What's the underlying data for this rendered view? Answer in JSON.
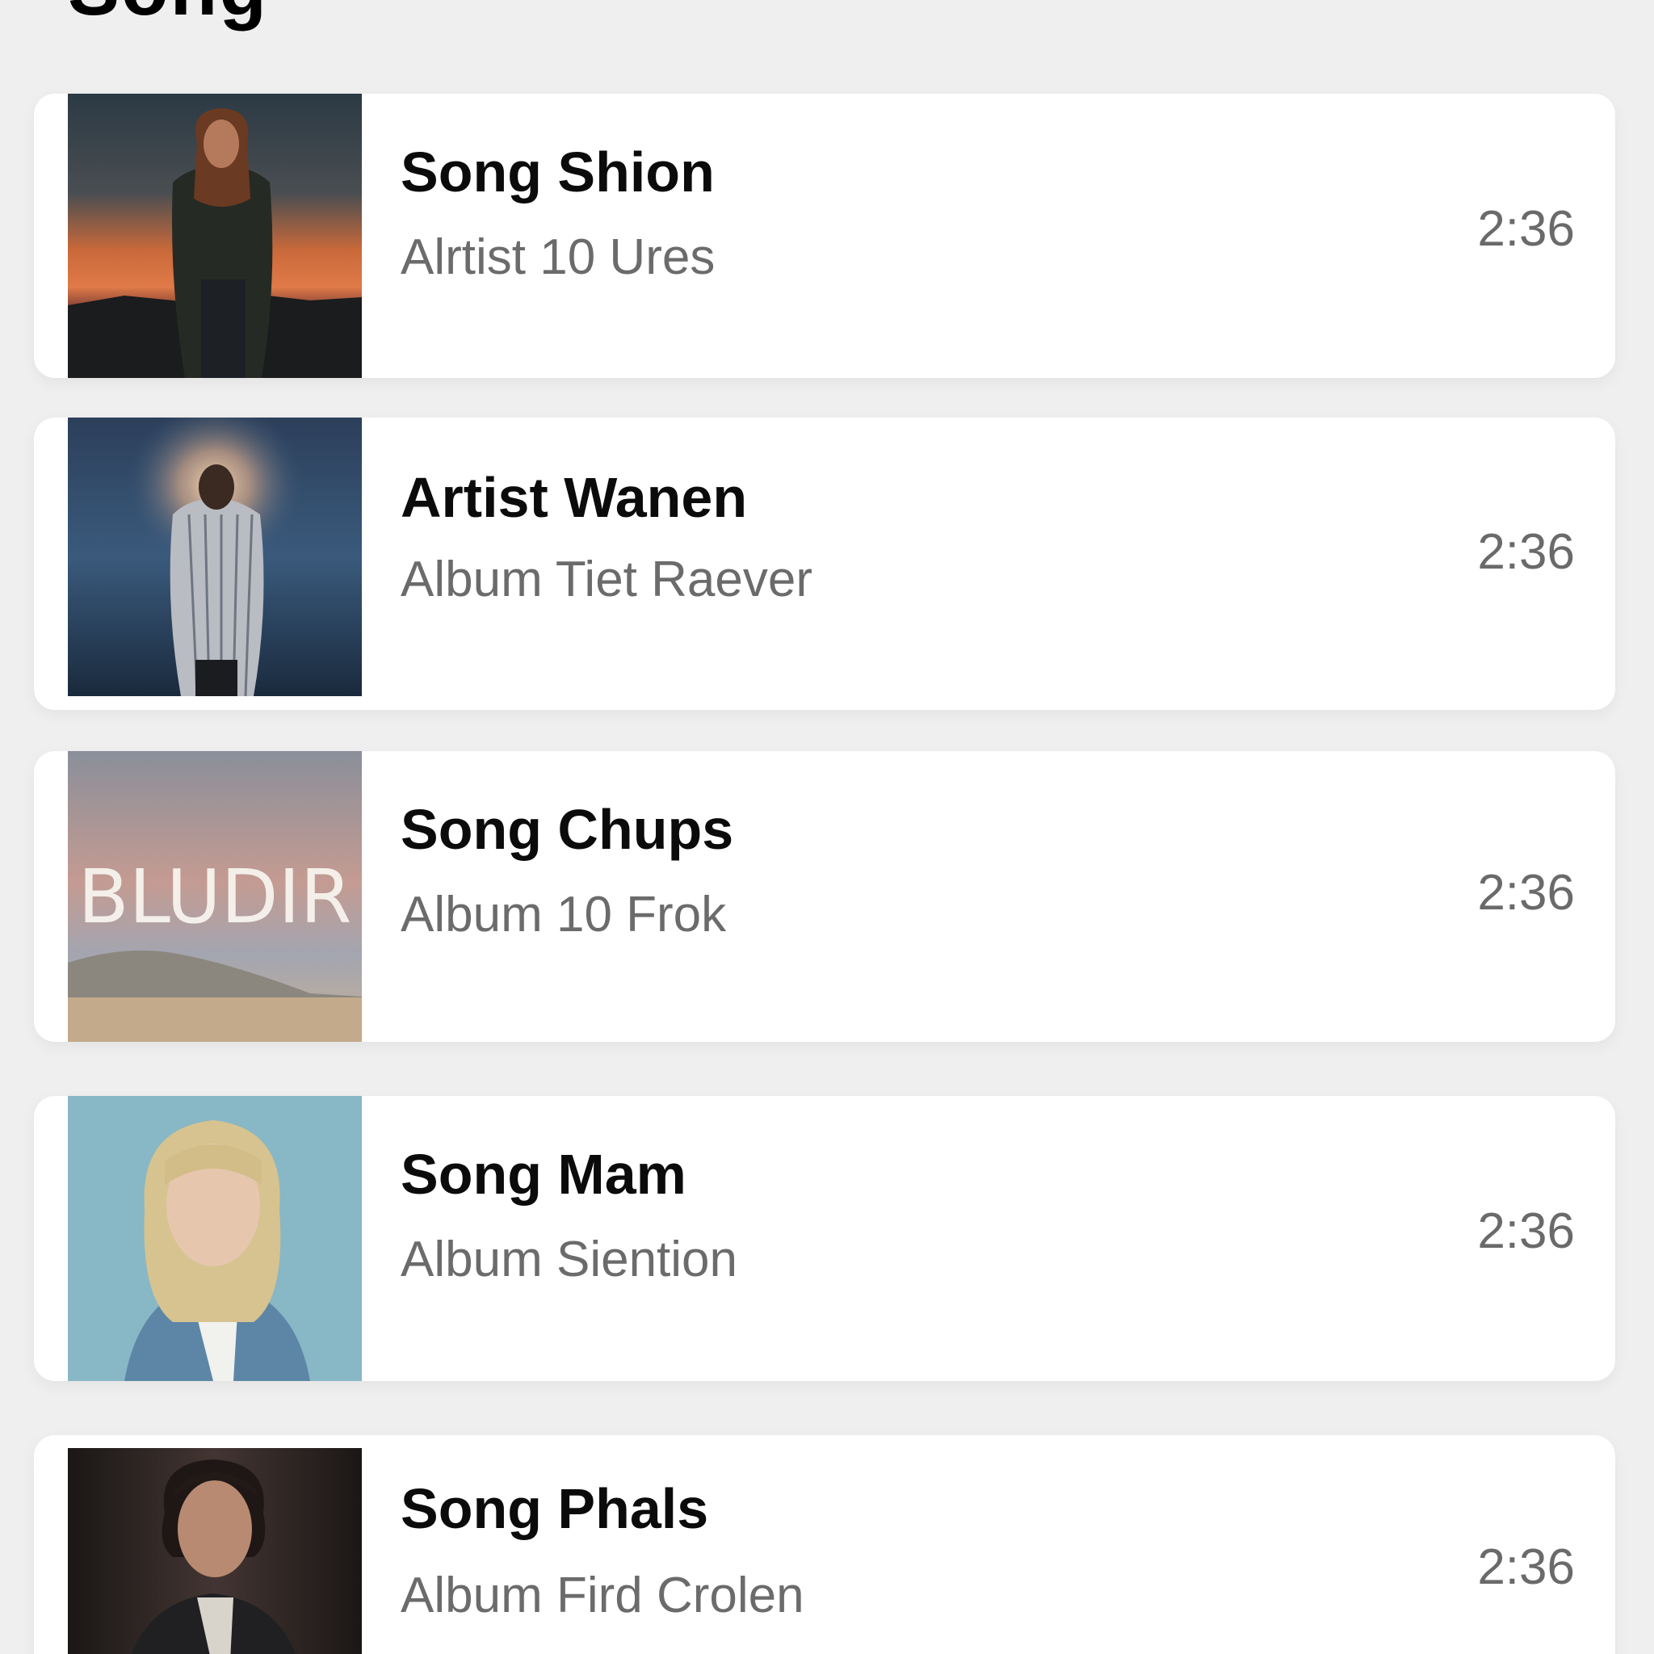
{
  "header": {
    "title": "Song"
  },
  "songs": [
    {
      "title": "Song Shion",
      "subtitle": "Alrtist 10 Ures",
      "duration": "2:36",
      "art_icon": "portrait-long-hair-sunset-artwork"
    },
    {
      "title": "Artist Wanen",
      "subtitle": "Album Tiet Raever",
      "duration": "2:36",
      "art_icon": "portrait-halo-sea-artwork"
    },
    {
      "title": "Song Chups",
      "subtitle": "Album 10 Frok",
      "duration": "2:36",
      "art_icon": "bludir-desert-artwork",
      "art_text": "BLUDIR"
    },
    {
      "title": "Song Mam",
      "subtitle": "Album Siention",
      "duration": "2:36",
      "art_icon": "portrait-blonde-denim-artwork"
    },
    {
      "title": "Song Phals",
      "subtitle": "Album Fird Crolen",
      "duration": "2:36",
      "art_icon": "portrait-curly-hair-suit-artwork"
    }
  ],
  "colors": {
    "background": "#efefef",
    "card": "#ffffff",
    "title_text": "#0b0b0b",
    "secondary_text": "#6b6b6b"
  }
}
